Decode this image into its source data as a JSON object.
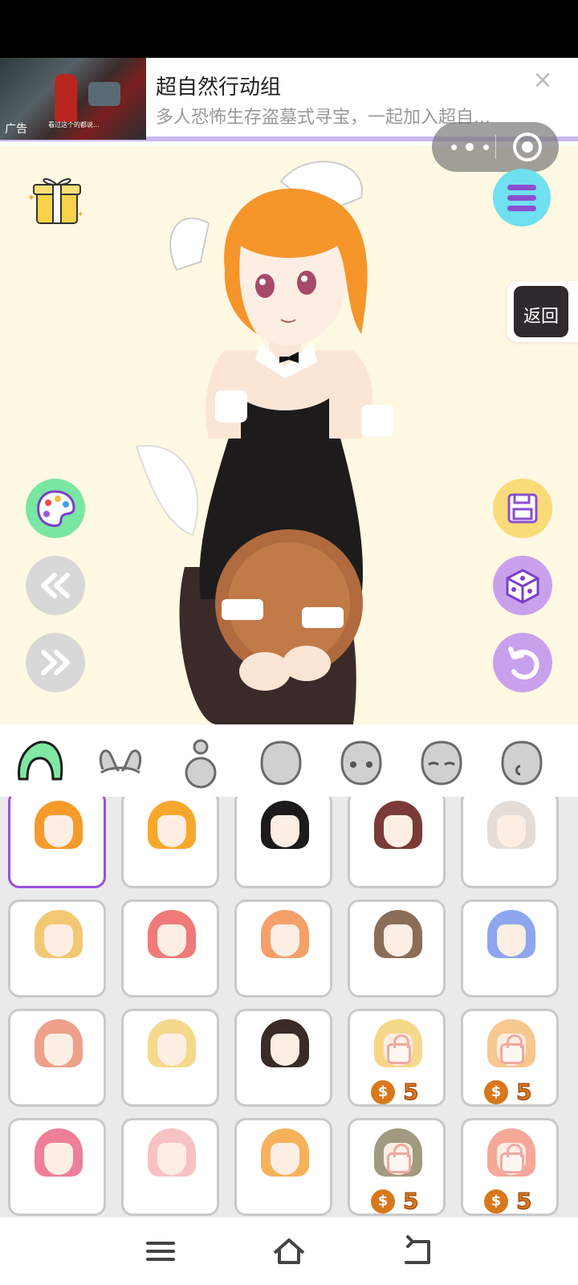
{
  "ad": {
    "thumb_label": "广告",
    "thumb_caption": "看过这个的都说...",
    "title": "超自然行动组",
    "description": "多人恐怖生存盗墓式寻宝，一起加入超自...",
    "close_symbol": "×"
  },
  "capsule": {
    "more_icon": "more-dots-icon",
    "exit_icon": "target-circle-icon"
  },
  "stage": {
    "background_color": "#fff8e2",
    "back_button_label": "返回",
    "left_buttons": [
      "palette-icon",
      "previous-icon",
      "next-icon"
    ],
    "right_buttons": [
      "save-icon",
      "dice-icon",
      "undo-icon"
    ]
  },
  "tabs": [
    "hair-tab-icon",
    "bunny-ears-tab-icon",
    "body-tab-icon",
    "head-tab-icon",
    "eyes-tab-icon",
    "face-tab-icon",
    "ear-tab-icon"
  ],
  "grid": {
    "items": [
      {
        "color": "#f59b2a",
        "locked": false,
        "price": ""
      },
      {
        "color": "#f7a82c",
        "locked": false,
        "price": ""
      },
      {
        "color": "#1c1a1c",
        "locked": false,
        "price": ""
      },
      {
        "color": "#7a3a38",
        "locked": false,
        "price": ""
      },
      {
        "color": "#e4dcd6",
        "locked": false,
        "price": ""
      },
      {
        "color": "#f3c873",
        "locked": false,
        "price": ""
      },
      {
        "color": "#ef7a78",
        "locked": false,
        "price": ""
      },
      {
        "color": "#f5a06a",
        "locked": false,
        "price": ""
      },
      {
        "color": "#8a6e5a",
        "locked": false,
        "price": ""
      },
      {
        "color": "#8ea6f0",
        "locked": false,
        "price": ""
      },
      {
        "color": "#eea08a",
        "locked": false,
        "price": ""
      },
      {
        "color": "#f4d88c",
        "locked": false,
        "price": ""
      },
      {
        "color": "#3a2a28",
        "locked": false,
        "price": ""
      },
      {
        "color": "#f6d88a",
        "locked": true,
        "price": "5"
      },
      {
        "color": "#f6c890",
        "locked": true,
        "price": "5"
      },
      {
        "color": "#ef7e98",
        "locked": false,
        "price": ""
      },
      {
        "color": "#f7c2c4",
        "locked": false,
        "price": ""
      },
      {
        "color": "#f5b25a",
        "locked": false,
        "price": ""
      },
      {
        "color": "#a09a80",
        "locked": true,
        "price": "5"
      },
      {
        "color": "#f5a89a",
        "locked": true,
        "price": "5"
      }
    ],
    "coin_symbol": "$",
    "selected_index": 0
  },
  "nav": [
    "menu-icon",
    "home-icon",
    "back-icon"
  ]
}
